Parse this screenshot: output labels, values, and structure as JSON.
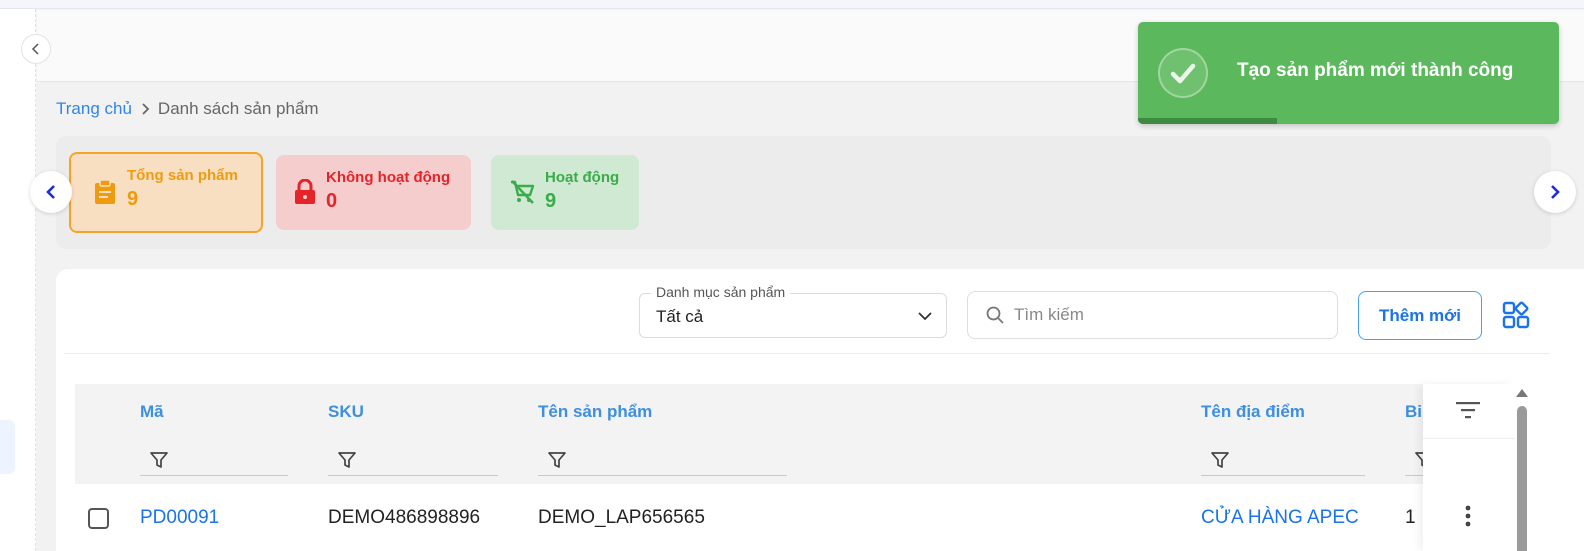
{
  "breadcrumb": {
    "home": "Trang chủ",
    "separator_icon": "chevron-right-icon",
    "current": "Danh sách sản phẩm"
  },
  "stats": {
    "total": {
      "label": "Tổng sản phẩm",
      "value": "9",
      "icon": "clipboard-icon",
      "color": "#ef9b10"
    },
    "inactive": {
      "label": "Không hoạt động",
      "value": "0",
      "icon": "lock-icon",
      "color": "#e5242a"
    },
    "active": {
      "label": "Hoạt động",
      "value": "9",
      "icon": "cart-off-icon",
      "color": "#3aac4a"
    }
  },
  "toolbar": {
    "category_label": "Danh mục sản phẩm",
    "category_value": "Tất cả",
    "search_placeholder": "Tìm kiếm",
    "add_label": "Thêm mới"
  },
  "table": {
    "columns": [
      "Mã",
      "SKU",
      "Tên sản phẩm",
      "Tên địa điểm",
      "Bi"
    ],
    "rows": [
      {
        "code": "PD00091",
        "sku": "DEMO486898896",
        "name": "DEMO_LAP656565",
        "location": "CỬA HÀNG APEC",
        "extra": "1"
      }
    ]
  },
  "toast": {
    "message": "Tạo sản phẩm mới thành công",
    "progress": 0.33,
    "color": "#5cb85c"
  }
}
